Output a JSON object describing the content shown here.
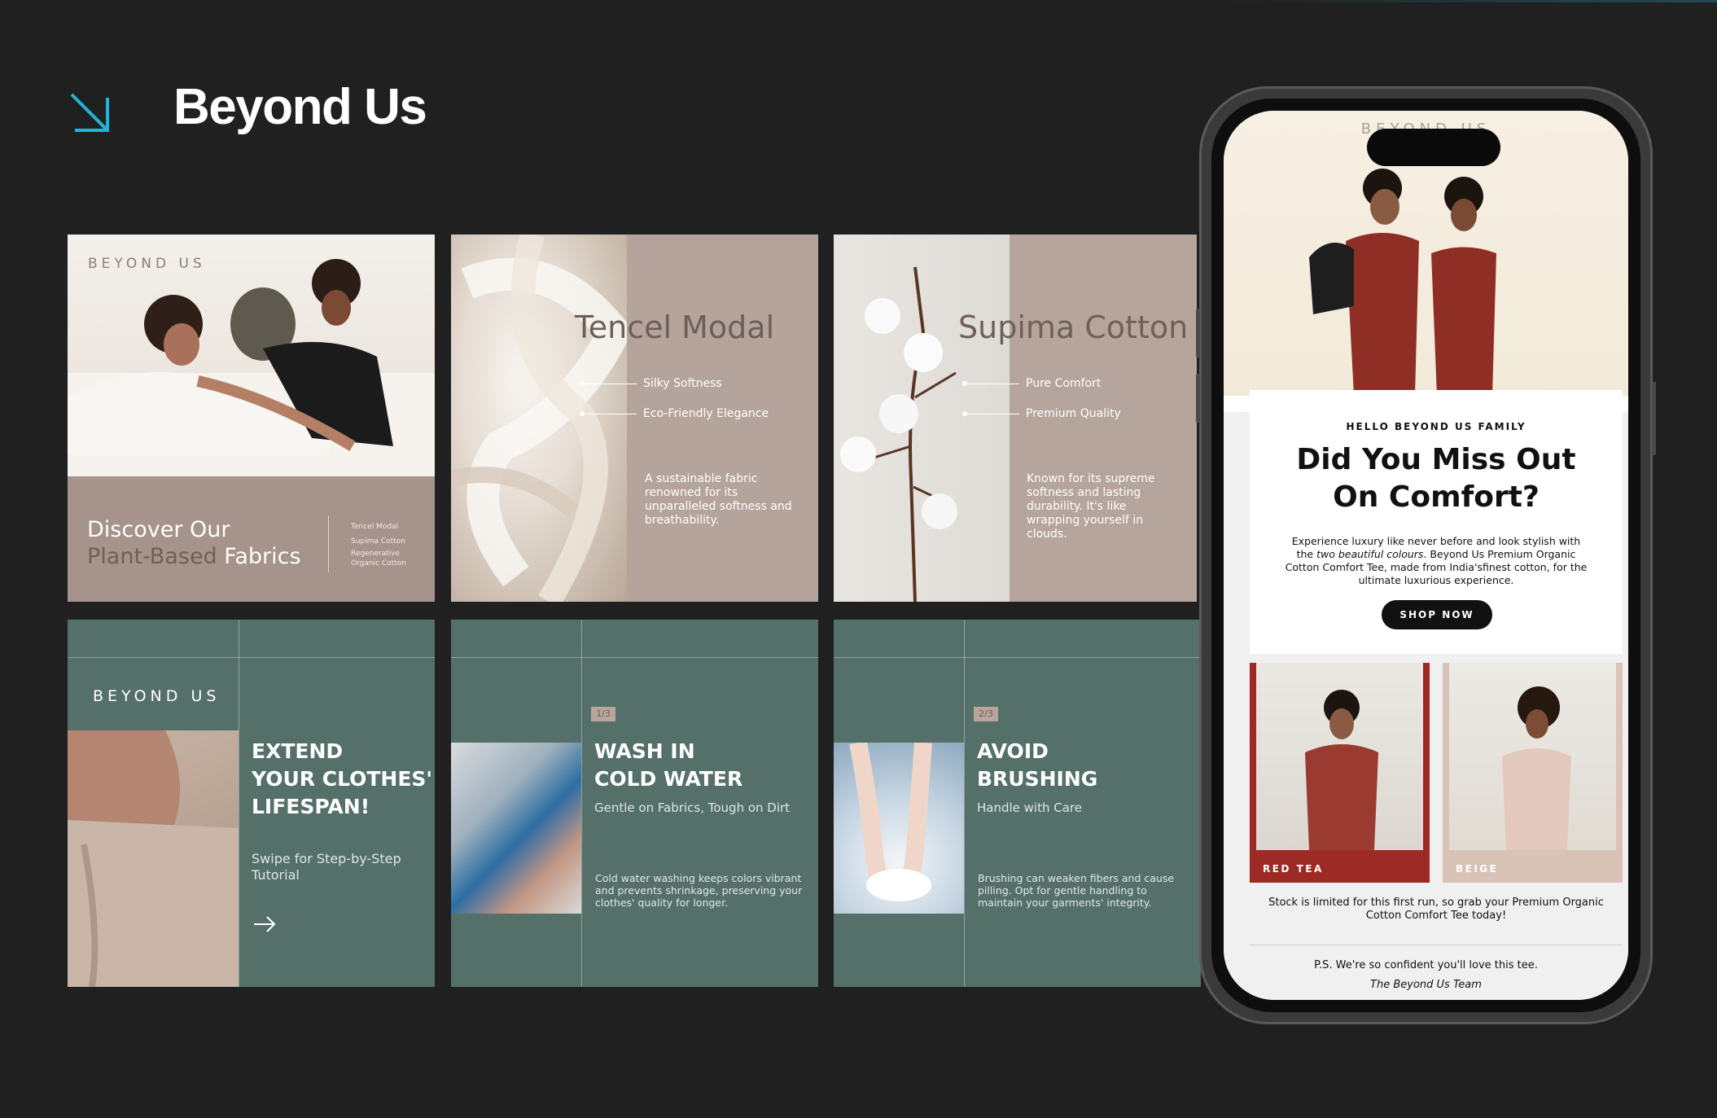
{
  "header": {
    "title": "Beyond Us",
    "accent": "#1fb4d9"
  },
  "tiles": {
    "t1": {
      "brand": "BEYOND US",
      "headline_white_1": "Discover Our",
      "headline_dark": "Plant-Based",
      "headline_white_2": "Fabrics",
      "list": [
        "Tencel Modal",
        "Supima Cotton",
        "Regenerative",
        "Organic Cotton"
      ]
    },
    "t2": {
      "heading": "Tencel Modal",
      "bullets": [
        "Silky Softness",
        "Eco-Friendly Elegance"
      ],
      "desc": "A sustainable fabric renowned for its unparalleled softness and breathability."
    },
    "t3": {
      "heading": "Supima Cotton",
      "bullets": [
        "Pure Comfort",
        "Premium Quality"
      ],
      "desc": "Known for its supreme softness and lasting durability. It's like wrapping yourself in clouds."
    },
    "t4": {
      "brand": "BEYOND US",
      "headline": [
        "EXTEND",
        "YOUR CLOTHES'",
        "LIFESPAN!"
      ],
      "sub": "Swipe for Step-by-Step Tutorial"
    },
    "t5": {
      "badge": "1/3",
      "headline": [
        "WASH IN",
        "COLD WATER"
      ],
      "sub": "Gentle on Fabrics, Tough on Dirt",
      "fine": "Cold water washing keeps colors vibrant and prevents shrinkage, preserving your clothes' quality for longer."
    },
    "t6": {
      "badge": "2/3",
      "headline": [
        "AVOID",
        "BRUSHING"
      ],
      "sub": "Handle with Care",
      "fine": "Brushing can weaken fibers and cause pilling. Opt for gentle handling to maintain your garments' integrity."
    }
  },
  "phone": {
    "hero_brand": "BEYOND US",
    "eyebrow": "HELLO BEYOND US FAMILY",
    "title_1": "Did You Miss Out",
    "title_2": "On Comfort?",
    "body_1": "Experience luxury like never before and look stylish with the ",
    "body_em": "two beautiful colours",
    "body_2": ". Beyond Us Premium Organic Cotton Comfort Tee, made from India'sfinest cotton, for the ultimate luxurious experience.",
    "cta": "SHOP NOW",
    "products": [
      {
        "label": "RED TEA",
        "color": "#9e2a26"
      },
      {
        "label": "BEIGE",
        "color": "#d8c3b6"
      }
    ],
    "stock": "Stock is limited for this first run, so grab your Premium Organic Cotton Comfort Tee today!",
    "ps": "P.S. We're so confident you'll love this tee.",
    "signature": "The Beyond Us Team"
  }
}
